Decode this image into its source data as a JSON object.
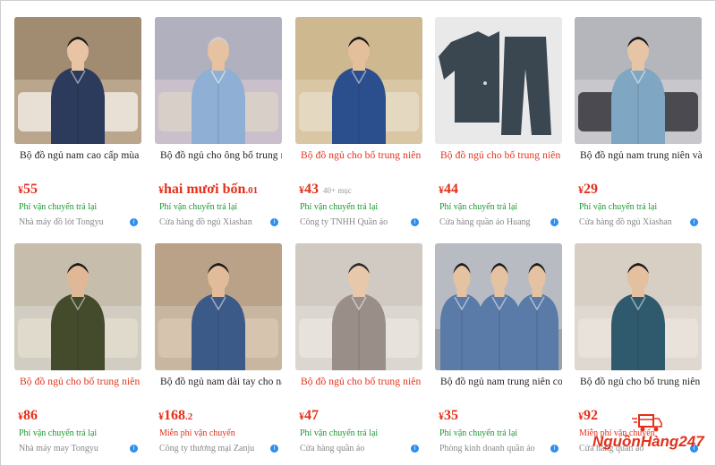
{
  "colors": {
    "price": "#e4301a",
    "shipping": "#1a9a2e",
    "badge": "#2d8ef0"
  },
  "products": [
    {
      "title": "Bộ đồ ngủ nam cao cấp mùa",
      "title_red": false,
      "currency": "¥",
      "price": "55",
      "decimal": "",
      "extra": "",
      "shipping": "Phí vận chuyển trả lại",
      "shipping_red": false,
      "shop": "Nhà máy đồ lót Tongyu",
      "image": "man-navy-pajama-sofa"
    },
    {
      "title": "Bộ đồ ngủ cho ông bố trung n",
      "title_red": false,
      "currency": "¥",
      "price": "hai mươi bốn",
      "decimal": ".01",
      "extra": "",
      "shipping": "Phí vận chuyển trả lại",
      "shipping_red": false,
      "shop": "Cửa hàng đồ ngủ Xiashan",
      "image": "grey-hair-man-light-blue-pajama"
    },
    {
      "title": "Bộ đồ ngủ cho bố trung niên",
      "title_red": true,
      "currency": "¥",
      "price": "43",
      "decimal": "",
      "extra": "40+ mục",
      "shipping": "Phí vận chuyển trả lại",
      "shipping_red": false,
      "shop": "Công ty TNHH Quần áo",
      "image": "man-blue-stripe-pajama"
    },
    {
      "title": "Bộ đồ ngủ cho bố trung niên",
      "title_red": true,
      "currency": "¥",
      "price": "44",
      "decimal": "",
      "extra": "",
      "shipping": "Phí vận chuyển trả lại",
      "shipping_red": false,
      "shop": "Cửa hàng quần áo Huang",
      "image": "flat-lay-dark-pajama"
    },
    {
      "title": "Bộ đồ ngủ nam trung niên và",
      "title_red": false,
      "currency": "¥",
      "price": "29",
      "decimal": "",
      "extra": "",
      "shipping": "Phí vận chuyển trả lại",
      "shipping_red": false,
      "shop": "Cửa hàng đồ ngủ Xiashan",
      "image": "man-blue-print-pajama-chair"
    },
    {
      "title": "Bộ đồ ngủ cho bố trung niên",
      "title_red": true,
      "currency": "¥",
      "price": "86",
      "decimal": "",
      "extra": "",
      "shipping": "Phí vận chuyển trả lại",
      "shipping_red": false,
      "shop": "Nhà máy may Tongyu",
      "image": "man-olive-pajama-phone"
    },
    {
      "title": "Bộ đồ ngủ nam dài tay cho na",
      "title_red": false,
      "currency": "¥",
      "price": "168",
      "decimal": ".2",
      "extra": "",
      "shipping": "Miễn phí vận chuyển",
      "shipping_red": true,
      "shop": "Công ty thương mại Zanju",
      "image": "man-blue-pattern-pajama"
    },
    {
      "title": "Bộ đồ ngủ cho bố trung niên",
      "title_red": true,
      "currency": "¥",
      "price": "47",
      "decimal": "",
      "extra": "",
      "shipping": "Phí vận chuyển trả lại",
      "shipping_red": false,
      "shop": "Cửa hàng quần áo",
      "image": "man-grey-pajama-sitting"
    },
    {
      "title": "Bộ đồ ngủ nam trung niên cot",
      "title_red": false,
      "currency": "¥",
      "price": "35",
      "decimal": "",
      "extra": "",
      "shipping": "Phí vận chuyển trả lại",
      "shipping_red": false,
      "shop": "Phòng kinh doanh quần áo",
      "image": "three-men-blue-pajama"
    },
    {
      "title": "Bộ đồ ngủ cho bố trung niên",
      "title_red": false,
      "currency": "¥",
      "price": "92",
      "decimal": "",
      "extra": "",
      "shipping": "Miễn phí vận chuyển",
      "shipping_red": true,
      "shop": "Cửa hàng quần áo",
      "image": "man-teal-pajama-standing"
    }
  ],
  "logo": {
    "text_main": "NguồnHàng",
    "text_num": "247"
  }
}
